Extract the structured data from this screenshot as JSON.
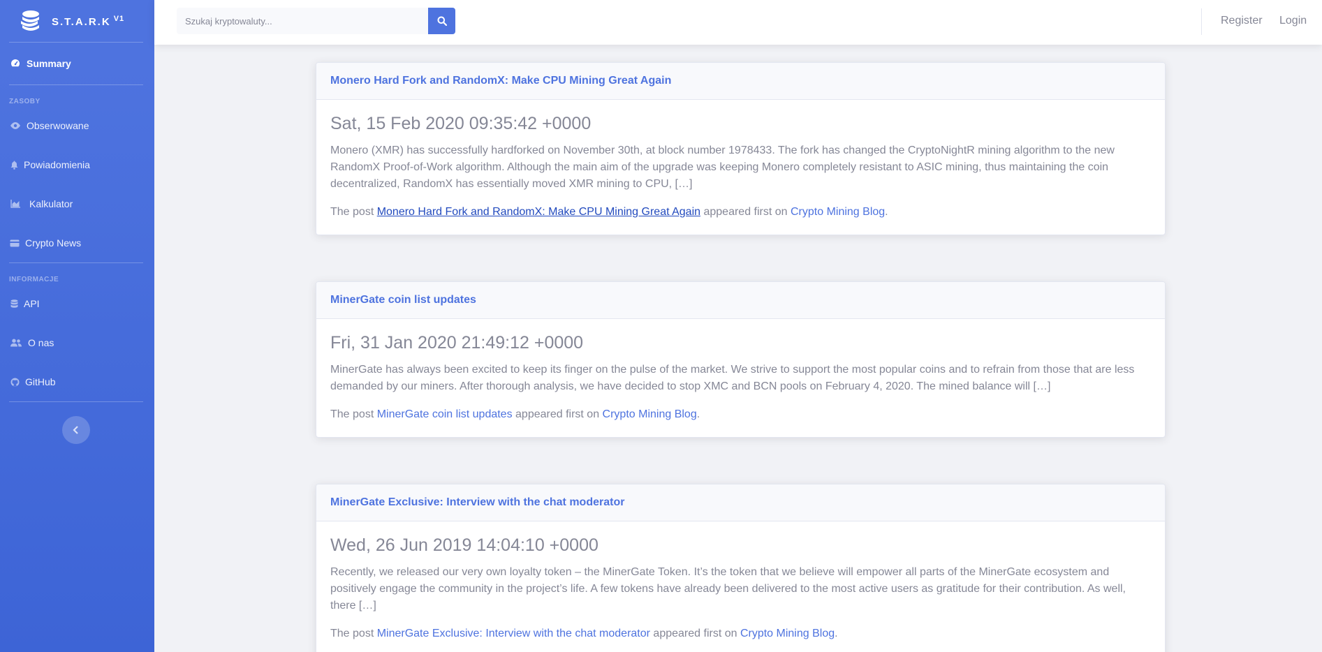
{
  "brand": {
    "name": "S.T.A.R.K",
    "version": "V1",
    "icon": "coins-icon"
  },
  "sidebar": {
    "items": [
      {
        "label": "Summary",
        "icon": "tachometer-icon"
      },
      {
        "label": "Obserwowane",
        "icon": "eye-icon"
      },
      {
        "label": "Powiadomienia",
        "icon": "bell-icon"
      },
      {
        "label": "Kalkulator",
        "icon": "chart-area-icon"
      },
      {
        "label": "Crypto News",
        "icon": "credit-card-icon"
      },
      {
        "label": "API",
        "icon": "database-icon"
      },
      {
        "label": "O nas",
        "icon": "users-icon"
      },
      {
        "label": "GitHub",
        "icon": "github-icon"
      }
    ],
    "sections": {
      "resources": "ZASOBY",
      "info": "INFORMACJE"
    },
    "toggle_icon": "chevron-left-icon"
  },
  "topbar": {
    "search_placeholder": "Szukaj kryptowaluty...",
    "register": "Register",
    "login": "Login"
  },
  "posts": [
    {
      "title": "Monero Hard Fork and RandomX: Make CPU Mining Great Again",
      "date": "Sat, 15 Feb 2020 09:35:42 +0000",
      "excerpt": "Monero (XMR) has successfully hardforked on November 30th, at block number 1978433. The fork has changed the CryptoNightR mining algorithm to the new RandomX Proof-of-Work algorithm.   Although the main aim of the upgrade was keeping Monero completely resistant to ASIC mining, thus maintaining the coin decentralized, RandomX has essentially moved XMR mining to CPU, […]",
      "foot_pre": "The post ",
      "foot_link": "Monero Hard Fork and RandomX: Make CPU Mining Great Again",
      "foot_mid": " appeared first on ",
      "blog": "Crypto Mining Blog",
      "foot_end": "."
    },
    {
      "title": "MinerGate coin list updates",
      "date": "Fri, 31 Jan 2020 21:49:12 +0000",
      "excerpt": "MinerGate has always been excited to keep its finger on the pulse of the market. We strive to support the most popular coins and to refrain from those that are less demanded by our miners. After thorough analysis, we have decided to stop XMC and BCN pools on February 4, 2020. The mined balance will […]",
      "foot_pre": "The post ",
      "foot_link": "MinerGate coin list updates",
      "foot_mid": " appeared first on ",
      "blog": "Crypto Mining Blog",
      "foot_end": "."
    },
    {
      "title": "MinerGate Exclusive: Interview with the chat moderator",
      "date": "Wed, 26 Jun 2019 14:04:10 +0000",
      "excerpt": "Recently, we released our very own loyalty token – the MinerGate Token.  It’s the token that we believe will empower all parts of the MinerGate ecosystem and positively engage the community in the project’s life.  A few tokens have already been delivered to the most active users as gratitude for their contribution. As well, there […]",
      "foot_pre": "The post ",
      "foot_link": "MinerGate Exclusive: Interview with the chat moderator",
      "foot_mid": " appeared first on ",
      "blog": "Crypto Mining Blog",
      "foot_end": "."
    }
  ]
}
